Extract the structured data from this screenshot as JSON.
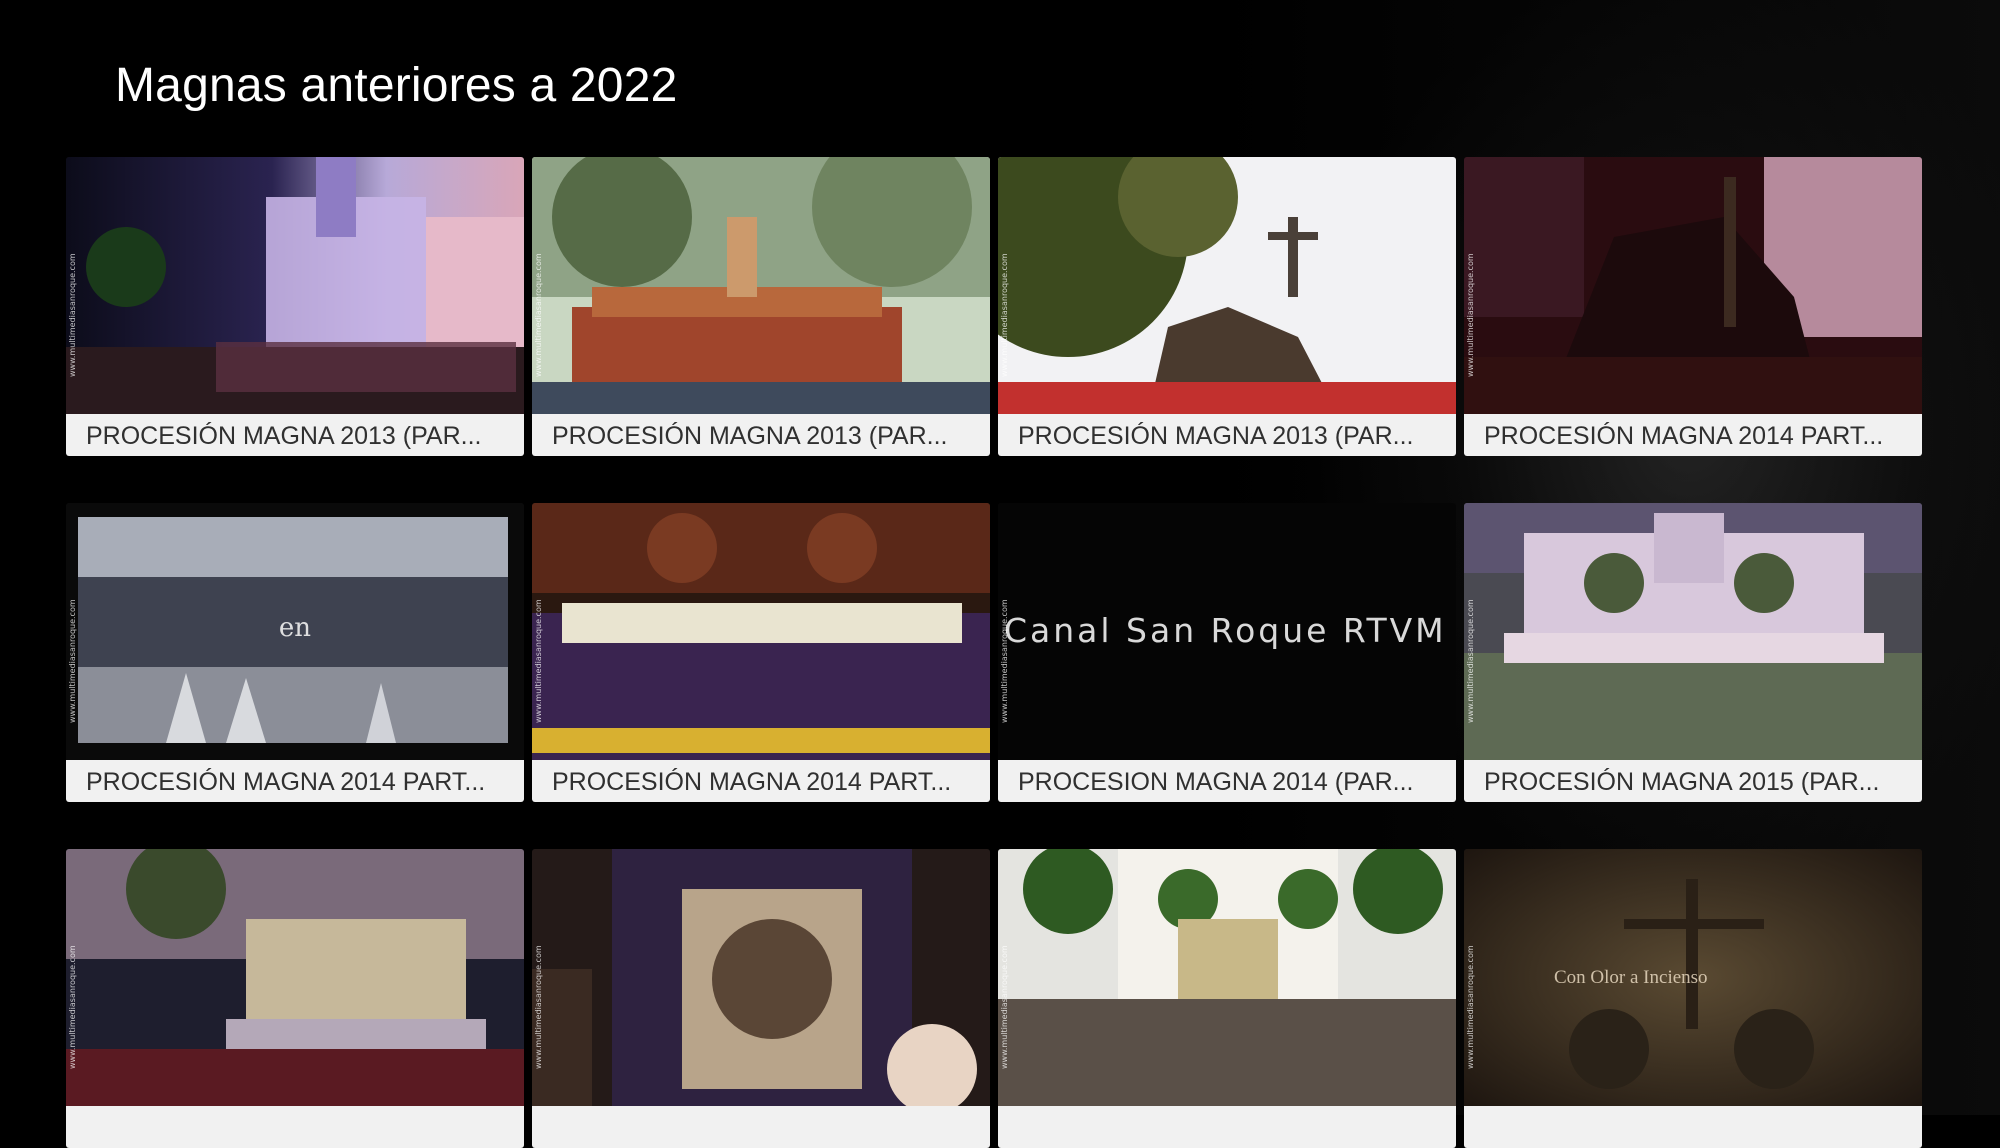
{
  "page": {
    "title": "Magnas anteriores a 2022"
  },
  "watermark": "www.multimediasanroque.com",
  "videos": [
    {
      "title": "PROCESIÓN MAGNA 2013 (PAR..."
    },
    {
      "title": "PROCESIÓN MAGNA 2013 (PAR..."
    },
    {
      "title": "PROCESIÓN MAGNA 2013 (PAR..."
    },
    {
      "title": "PROCESIÓN MAGNA 2014 PART..."
    },
    {
      "title": "PROCESIÓN MAGNA 2014 PART...",
      "overlay": "en"
    },
    {
      "title": "PROCESIÓN MAGNA 2014 PART..."
    },
    {
      "title": "PROCESION MAGNA 2014 (PAR...",
      "overlay": "Canal San Roque RTVM"
    },
    {
      "title": "PROCESIÓN MAGNA 2015 (PAR..."
    },
    {
      "title": ""
    },
    {
      "title": ""
    },
    {
      "title": ""
    },
    {
      "title": "",
      "overlay": "Con Olor a Incienso"
    }
  ],
  "colors": {
    "background": "#000000",
    "title_text": "#ffffff",
    "label_background": "#f1f1f1",
    "label_text": "#303030"
  }
}
